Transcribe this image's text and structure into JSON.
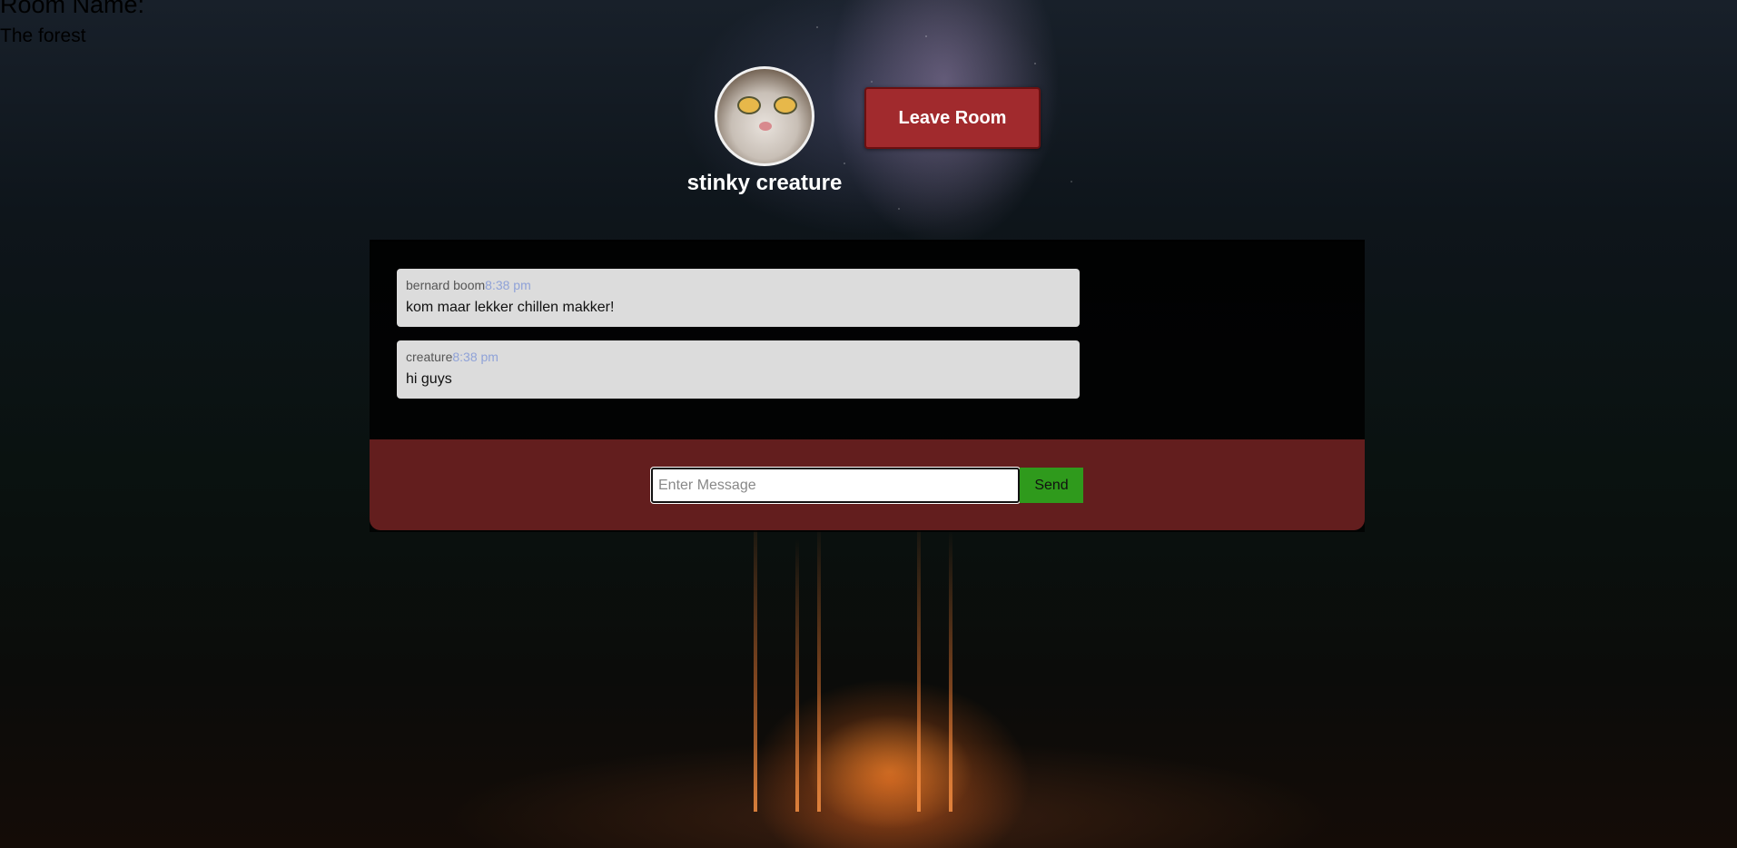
{
  "header": {
    "room_title": "Room Name:",
    "room_subtitle": "The forest"
  },
  "profile": {
    "username": "stinky creature",
    "avatar_icon": "cat-avatar"
  },
  "actions": {
    "leave_label": "Leave Room"
  },
  "messages": [
    {
      "author": "bernard boom",
      "time": "8:38 pm",
      "text": "kom maar lekker chillen makker!"
    },
    {
      "author": "creature",
      "time": "8:38 pm",
      "text": "hi guys"
    }
  ],
  "composer": {
    "placeholder": "Enter Message",
    "send_label": "Send"
  },
  "colors": {
    "leave_button": "#a12a2d",
    "input_bar": "#631e1e",
    "send_button": "#2f9a1c",
    "message_time": "#8fa2d8"
  }
}
